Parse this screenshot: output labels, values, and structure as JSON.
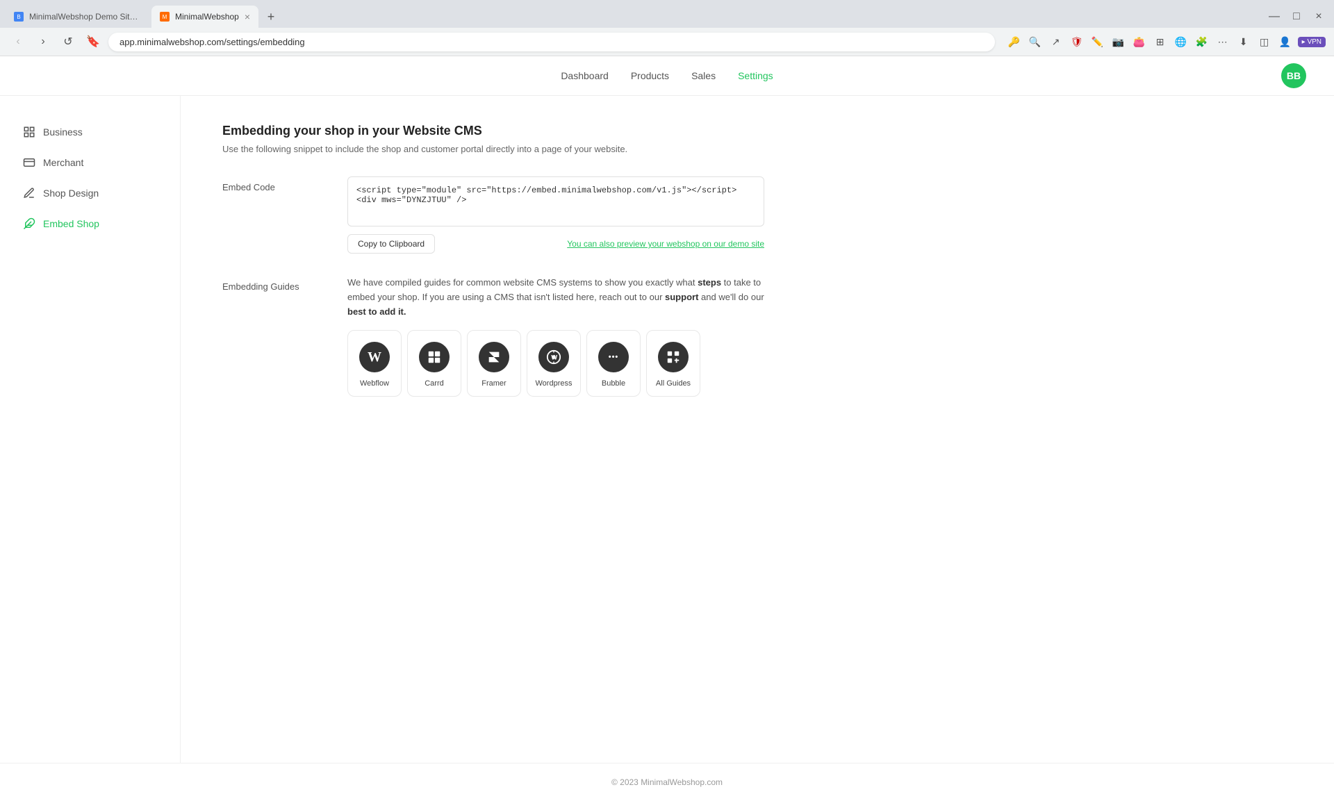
{
  "browser": {
    "tabs": [
      {
        "id": "tab1",
        "label": "MinimalWebshop Demo Site | Bubble",
        "favicon_type": "blue",
        "active": false
      },
      {
        "id": "tab2",
        "label": "MinimalWebshop",
        "favicon_type": "orange",
        "active": true
      }
    ],
    "address": "app.minimalwebshop.com/settings/embedding"
  },
  "nav": {
    "links": [
      {
        "id": "dashboard",
        "label": "Dashboard",
        "active": false
      },
      {
        "id": "products",
        "label": "Products",
        "active": false
      },
      {
        "id": "sales",
        "label": "Sales",
        "active": false
      },
      {
        "id": "settings",
        "label": "Settings",
        "active": true
      }
    ],
    "avatar_initials": "BB"
  },
  "sidebar": {
    "items": [
      {
        "id": "business",
        "label": "Business",
        "icon": "🏢",
        "active": false
      },
      {
        "id": "merchant",
        "label": "Merchant",
        "icon": "💳",
        "active": false
      },
      {
        "id": "shop-design",
        "label": "Shop Design",
        "icon": "✏️",
        "active": false
      },
      {
        "id": "embed-shop",
        "label": "Embed Shop",
        "icon": "🧩",
        "active": true
      }
    ]
  },
  "content": {
    "title": "Embedding your shop in your Website CMS",
    "description": "Use the following snippet to include the shop and customer portal directly into a page of your website.",
    "embed_code_label": "Embed Code",
    "embed_code_value": "<script type=\"module\" src=\"https://embed.minimalwebshop.com/v1.js\"></script>\n<div mws=\"DYNZJTUU\" />",
    "copy_button_label": "Copy to Clipboard",
    "preview_link_label": "You can also preview your webshop on our demo site",
    "guides_label": "Embedding Guides",
    "guides_description": "We have compiled guides for common website CMS systems to show you exactly what steps to take to embed your shop. If you are using a CMS that isn't listed here, reach out to our support and we'll do our best to add it.",
    "guides": [
      {
        "id": "webflow",
        "label": "Webflow",
        "symbol": "W"
      },
      {
        "id": "carrd",
        "label": "Carrd",
        "symbol": "📦"
      },
      {
        "id": "framer",
        "label": "Framer",
        "symbol": "◀"
      },
      {
        "id": "wordpress",
        "label": "Wordpress",
        "symbol": "W"
      },
      {
        "id": "bubble",
        "label": "Bubble",
        "symbol": "•••"
      },
      {
        "id": "all-guides",
        "label": "All Guides",
        "symbol": "⊞"
      }
    ]
  },
  "footer": {
    "text": "© 2023 MinimalWebshop.com"
  }
}
